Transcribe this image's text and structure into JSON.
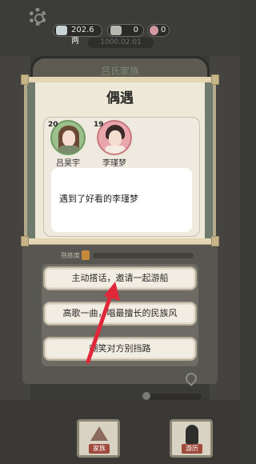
{
  "hud": {
    "money": "202.6两",
    "count_a": "0",
    "count_b": "0",
    "ghost_timer": "1000.02.01",
    "banner": "吕氏家族"
  },
  "dialog": {
    "title": "偶遇",
    "characters": [
      {
        "name": "吕昊宇",
        "age": "20",
        "avatar_color": "#9bc08c"
      },
      {
        "name": "李瑾梦",
        "age": "19",
        "avatar_color": "#e9a6ad"
      }
    ],
    "message": "遇到了好看的李瑾梦"
  },
  "progress": {
    "label": "熟练度",
    "fill": 0
  },
  "choices": [
    "主动搭话，邀请一起游船",
    "高歌一曲，唱最擅长的民族风",
    "嘲笑对方别挡路"
  ],
  "nav": {
    "family": "家族",
    "travel": "游历"
  },
  "colors": {
    "accent_red": "#e0283a",
    "frame": "#6f7b6c",
    "parchment": "#ede8d8"
  }
}
